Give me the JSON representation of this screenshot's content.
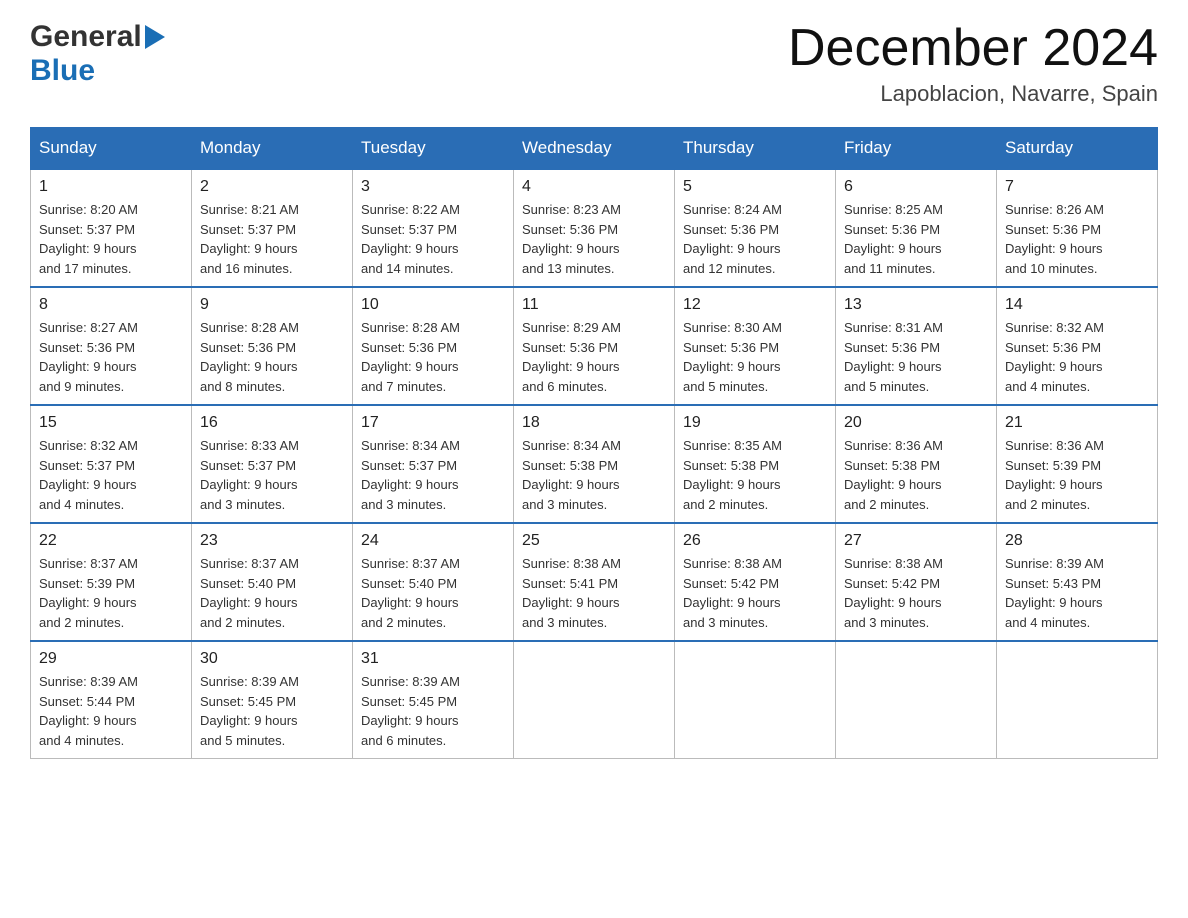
{
  "header": {
    "logo_general": "General",
    "logo_blue": "Blue",
    "month_title": "December 2024",
    "location": "Lapoblacion, Navarre, Spain"
  },
  "weekdays": [
    "Sunday",
    "Monday",
    "Tuesday",
    "Wednesday",
    "Thursday",
    "Friday",
    "Saturday"
  ],
  "rows": [
    [
      {
        "day": "1",
        "sunrise": "8:20 AM",
        "sunset": "5:37 PM",
        "daylight": "9 hours and 17 minutes."
      },
      {
        "day": "2",
        "sunrise": "8:21 AM",
        "sunset": "5:37 PM",
        "daylight": "9 hours and 16 minutes."
      },
      {
        "day": "3",
        "sunrise": "8:22 AM",
        "sunset": "5:37 PM",
        "daylight": "9 hours and 14 minutes."
      },
      {
        "day": "4",
        "sunrise": "8:23 AM",
        "sunset": "5:36 PM",
        "daylight": "9 hours and 13 minutes."
      },
      {
        "day": "5",
        "sunrise": "8:24 AM",
        "sunset": "5:36 PM",
        "daylight": "9 hours and 12 minutes."
      },
      {
        "day": "6",
        "sunrise": "8:25 AM",
        "sunset": "5:36 PM",
        "daylight": "9 hours and 11 minutes."
      },
      {
        "day": "7",
        "sunrise": "8:26 AM",
        "sunset": "5:36 PM",
        "daylight": "9 hours and 10 minutes."
      }
    ],
    [
      {
        "day": "8",
        "sunrise": "8:27 AM",
        "sunset": "5:36 PM",
        "daylight": "9 hours and 9 minutes."
      },
      {
        "day": "9",
        "sunrise": "8:28 AM",
        "sunset": "5:36 PM",
        "daylight": "9 hours and 8 minutes."
      },
      {
        "day": "10",
        "sunrise": "8:28 AM",
        "sunset": "5:36 PM",
        "daylight": "9 hours and 7 minutes."
      },
      {
        "day": "11",
        "sunrise": "8:29 AM",
        "sunset": "5:36 PM",
        "daylight": "9 hours and 6 minutes."
      },
      {
        "day": "12",
        "sunrise": "8:30 AM",
        "sunset": "5:36 PM",
        "daylight": "9 hours and 5 minutes."
      },
      {
        "day": "13",
        "sunrise": "8:31 AM",
        "sunset": "5:36 PM",
        "daylight": "9 hours and 5 minutes."
      },
      {
        "day": "14",
        "sunrise": "8:32 AM",
        "sunset": "5:36 PM",
        "daylight": "9 hours and 4 minutes."
      }
    ],
    [
      {
        "day": "15",
        "sunrise": "8:32 AM",
        "sunset": "5:37 PM",
        "daylight": "9 hours and 4 minutes."
      },
      {
        "day": "16",
        "sunrise": "8:33 AM",
        "sunset": "5:37 PM",
        "daylight": "9 hours and 3 minutes."
      },
      {
        "day": "17",
        "sunrise": "8:34 AM",
        "sunset": "5:37 PM",
        "daylight": "9 hours and 3 minutes."
      },
      {
        "day": "18",
        "sunrise": "8:34 AM",
        "sunset": "5:38 PM",
        "daylight": "9 hours and 3 minutes."
      },
      {
        "day": "19",
        "sunrise": "8:35 AM",
        "sunset": "5:38 PM",
        "daylight": "9 hours and 2 minutes."
      },
      {
        "day": "20",
        "sunrise": "8:36 AM",
        "sunset": "5:38 PM",
        "daylight": "9 hours and 2 minutes."
      },
      {
        "day": "21",
        "sunrise": "8:36 AM",
        "sunset": "5:39 PM",
        "daylight": "9 hours and 2 minutes."
      }
    ],
    [
      {
        "day": "22",
        "sunrise": "8:37 AM",
        "sunset": "5:39 PM",
        "daylight": "9 hours and 2 minutes."
      },
      {
        "day": "23",
        "sunrise": "8:37 AM",
        "sunset": "5:40 PM",
        "daylight": "9 hours and 2 minutes."
      },
      {
        "day": "24",
        "sunrise": "8:37 AM",
        "sunset": "5:40 PM",
        "daylight": "9 hours and 2 minutes."
      },
      {
        "day": "25",
        "sunrise": "8:38 AM",
        "sunset": "5:41 PM",
        "daylight": "9 hours and 3 minutes."
      },
      {
        "day": "26",
        "sunrise": "8:38 AM",
        "sunset": "5:42 PM",
        "daylight": "9 hours and 3 minutes."
      },
      {
        "day": "27",
        "sunrise": "8:38 AM",
        "sunset": "5:42 PM",
        "daylight": "9 hours and 3 minutes."
      },
      {
        "day": "28",
        "sunrise": "8:39 AM",
        "sunset": "5:43 PM",
        "daylight": "9 hours and 4 minutes."
      }
    ],
    [
      {
        "day": "29",
        "sunrise": "8:39 AM",
        "sunset": "5:44 PM",
        "daylight": "9 hours and 4 minutes."
      },
      {
        "day": "30",
        "sunrise": "8:39 AM",
        "sunset": "5:45 PM",
        "daylight": "9 hours and 5 minutes."
      },
      {
        "day": "31",
        "sunrise": "8:39 AM",
        "sunset": "5:45 PM",
        "daylight": "9 hours and 6 minutes."
      },
      null,
      null,
      null,
      null
    ]
  ],
  "labels": {
    "sunrise": "Sunrise:",
    "sunset": "Sunset:",
    "daylight": "Daylight:"
  }
}
